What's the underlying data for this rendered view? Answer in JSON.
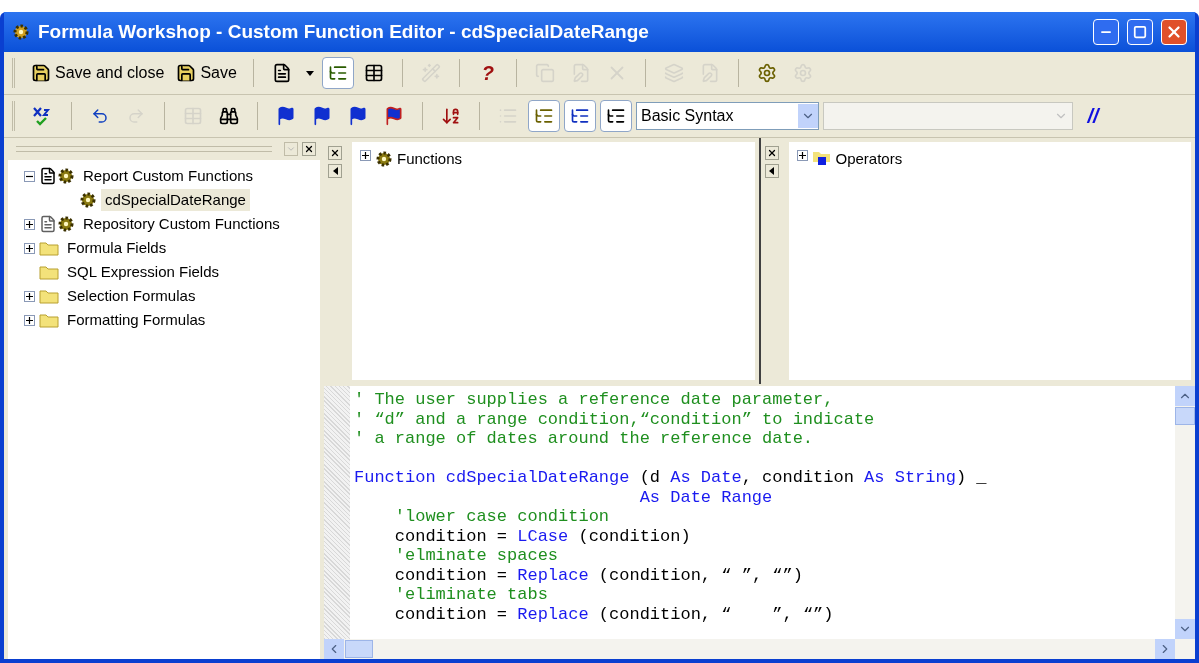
{
  "window": {
    "title": "Formula Workshop - Custom Function Editor - cdSpecialDateRange"
  },
  "toolbar_1": [
    {
      "kind": "labeled",
      "label": "Save and close",
      "disabled": false
    },
    {
      "kind": "labeled",
      "label": "Save",
      "disabled": false
    },
    {
      "kind": "sep"
    },
    {
      "kind": "icon",
      "disabled": false,
      "pressed": false
    },
    {
      "kind": "caret",
      "disabled": false
    },
    {
      "kind": "icon",
      "disabled": false,
      "pressed": true
    },
    {
      "kind": "icon",
      "disabled": false,
      "pressed": false
    },
    {
      "kind": "sep"
    },
    {
      "kind": "icon",
      "disabled": true,
      "pressed": false
    },
    {
      "kind": "sep"
    },
    {
      "kind": "text",
      "label": "?",
      "disabled": false
    },
    {
      "kind": "sep"
    },
    {
      "kind": "icon",
      "disabled": true,
      "pressed": false
    },
    {
      "kind": "icon",
      "disabled": true,
      "pressed": false
    },
    {
      "kind": "icon",
      "disabled": true,
      "pressed": false
    },
    {
      "kind": "sep"
    },
    {
      "kind": "icon",
      "disabled": true,
      "pressed": false
    },
    {
      "kind": "icon",
      "disabled": true,
      "pressed": false
    },
    {
      "kind": "sep"
    },
    {
      "kind": "icon",
      "disabled": false,
      "pressed": false
    },
    {
      "kind": "icon",
      "disabled": true,
      "pressed": false
    }
  ],
  "toolbar_2": [
    {
      "kind": "icon",
      "disabled": false,
      "pressed": false
    },
    {
      "kind": "sep"
    },
    {
      "kind": "icon",
      "disabled": false,
      "pressed": false
    },
    {
      "kind": "icon",
      "disabled": true,
      "pressed": false
    },
    {
      "kind": "sep"
    },
    {
      "kind": "icon",
      "disabled": true,
      "pressed": false
    },
    {
      "kind": "icon",
      "disabled": false,
      "pressed": false
    },
    {
      "kind": "sep"
    },
    {
      "kind": "icon",
      "disabled": false,
      "pressed": false
    },
    {
      "kind": "icon",
      "disabled": false,
      "pressed": false
    },
    {
      "kind": "icon",
      "disabled": false,
      "pressed": false
    },
    {
      "kind": "icon",
      "disabled": false,
      "pressed": false
    },
    {
      "kind": "sep"
    },
    {
      "kind": "icon",
      "disabled": false,
      "pressed": false
    },
    {
      "kind": "sep"
    },
    {
      "kind": "icon",
      "disabled": true,
      "pressed": false
    },
    {
      "kind": "icon",
      "disabled": false,
      "pressed": true
    },
    {
      "kind": "icon",
      "disabled": false,
      "pressed": true
    },
    {
      "kind": "icon",
      "disabled": false,
      "pressed": true
    },
    {
      "kind": "select",
      "value": "Basic Syntax",
      "disabled": false
    },
    {
      "kind": "select",
      "disabled": true
    },
    {
      "kind": "text",
      "label": "//",
      "disabled": false
    }
  ],
  "tree": [
    {
      "kind": "custom-functions",
      "label": "Report Custom Functions",
      "expanded": true,
      "selected": false,
      "children": [
        {
          "kind": "function",
          "label": "cdSpecialDateRange",
          "selected": true
        }
      ]
    },
    {
      "kind": "repository",
      "label": "Repository Custom Functions",
      "expanded": false,
      "selected": false
    },
    {
      "kind": "folder",
      "label": "Formula Fields",
      "expanded": false,
      "selected": false
    },
    {
      "kind": "folder",
      "label": "SQL Expression Fields",
      "selected": false
    },
    {
      "kind": "folder",
      "label": "Selection Formulas",
      "expanded": false,
      "selected": false
    },
    {
      "kind": "folder",
      "label": "Formatting Formulas",
      "expanded": false,
      "selected": false
    }
  ],
  "panes": [
    {
      "kind": "functions",
      "label": "Functions",
      "expanded": false
    },
    {
      "kind": "operators",
      "label": "Operators",
      "expanded": false
    }
  ],
  "code": [
    {
      "kind": "code",
      "segments": [
        {
          "kind": "comment",
          "text": "' The user supplies a reference date parameter,"
        }
      ]
    },
    {
      "kind": "code",
      "segments": [
        {
          "kind": "comment",
          "text": "' “d” and a range condition,“condition” to indicate"
        }
      ]
    },
    {
      "kind": "code",
      "segments": [
        {
          "kind": "comment",
          "text": "' a range of dates around the reference date."
        }
      ]
    },
    {
      "kind": "blank"
    },
    {
      "kind": "code",
      "segments": [
        {
          "kind": "keyword",
          "text": "Function cdSpecialDateRange"
        },
        {
          "kind": "plain",
          "text": " (d "
        },
        {
          "kind": "keyword",
          "text": "As Date"
        },
        {
          "kind": "plain",
          "text": ", condition "
        },
        {
          "kind": "keyword",
          "text": "As String"
        },
        {
          "kind": "plain",
          "text": ") _"
        }
      ]
    },
    {
      "kind": "code",
      "segments": [
        {
          "kind": "keyword",
          "text": "                            As Date Range"
        }
      ]
    },
    {
      "kind": "code",
      "segments": [
        {
          "kind": "comment",
          "text": "    'lower case condition"
        }
      ]
    },
    {
      "kind": "code",
      "segments": [
        {
          "kind": "plain",
          "text": "    condition = "
        },
        {
          "kind": "keyword",
          "text": "LCase"
        },
        {
          "kind": "plain",
          "text": " (condition)"
        }
      ]
    },
    {
      "kind": "code",
      "segments": [
        {
          "kind": "comment",
          "text": "    'elminate spaces"
        }
      ]
    },
    {
      "kind": "code",
      "segments": [
        {
          "kind": "plain",
          "text": "    condition = "
        },
        {
          "kind": "keyword",
          "text": "Replace"
        },
        {
          "kind": "plain",
          "text": " (condition, “ ”, “”)"
        }
      ]
    },
    {
      "kind": "code",
      "segments": [
        {
          "kind": "comment",
          "text": "    'eliminate tabs"
        }
      ]
    },
    {
      "kind": "code",
      "segments": [
        {
          "kind": "plain",
          "text": "    condition = "
        },
        {
          "kind": "keyword",
          "text": "Replace"
        },
        {
          "kind": "plain",
          "text": " (condition, “    ”, “”)"
        }
      ]
    }
  ]
}
